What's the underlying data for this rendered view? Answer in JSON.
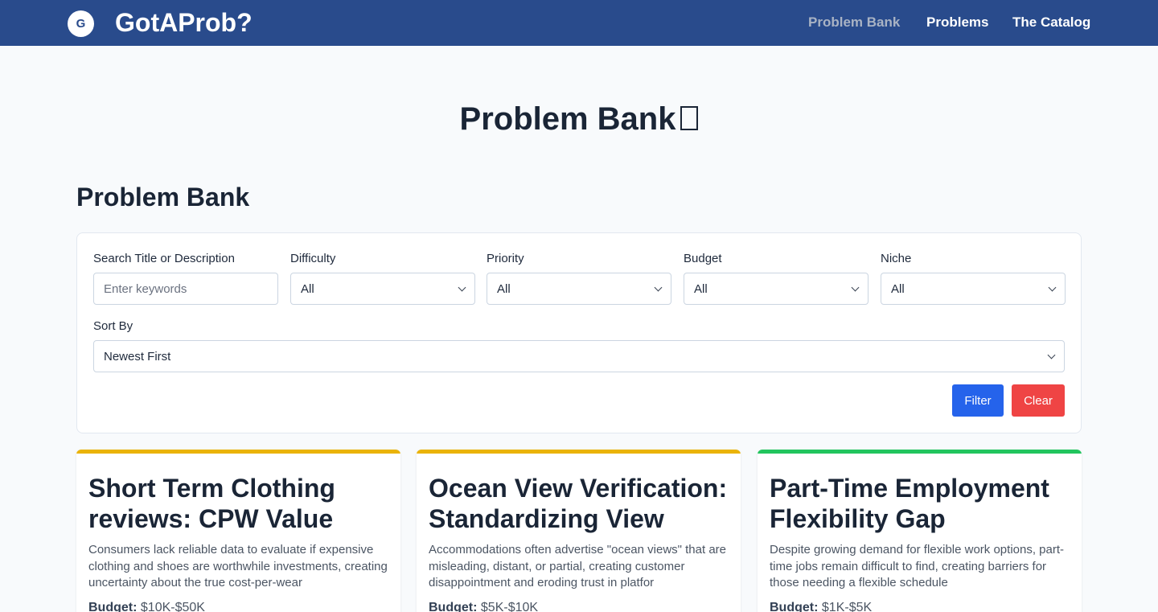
{
  "navbar": {
    "logo_letter": "G",
    "brand": "GotAProb?",
    "links": [
      {
        "label": "Problem Bank",
        "active": true
      },
      {
        "label": "Problems",
        "active": false
      },
      {
        "label": "The Catalog",
        "active": false
      }
    ],
    "bg_color": "#294b8c"
  },
  "hero": {
    "title": "Problem Bank"
  },
  "section": {
    "title": "Problem Bank"
  },
  "filters": {
    "search_label": "Search Title or Description",
    "search_placeholder": "Enter keywords",
    "difficulty_label": "Difficulty",
    "difficulty_value": "All",
    "priority_label": "Priority",
    "priority_value": "All",
    "budget_label": "Budget",
    "budget_value": "All",
    "niche_label": "Niche",
    "niche_value": "All",
    "sort_label": "Sort By",
    "sort_value": "Newest First",
    "filter_button": "Filter",
    "clear_button": "Clear"
  },
  "cards": [
    {
      "title": "Short Term Clothing reviews: CPW Value",
      "description": "Consumers lack reliable data to evaluate if expensive clothing and shoes are worthwhile investments, creating uncertainty about the true cost-per-wear",
      "budget_label": "Budget:",
      "budget_value": "$10K-$50K",
      "accent_color": "#eab308"
    },
    {
      "title": "Ocean View Verification: Standardizing View",
      "description": "Accommodations often advertise \"ocean views\" that are misleading, distant, or partial, creating customer disappointment and eroding trust in platfor",
      "budget_label": "Budget:",
      "budget_value": "$5K-$10K",
      "accent_color": "#eab308"
    },
    {
      "title": "Part-Time Employment Flexibility Gap",
      "description": "Despite growing demand for flexible work options, part-time jobs remain difficult to find, creating barriers for those needing a flexible schedule",
      "budget_label": "Budget:",
      "budget_value": "$1K-$5K",
      "accent_color": "#22c55e"
    }
  ]
}
